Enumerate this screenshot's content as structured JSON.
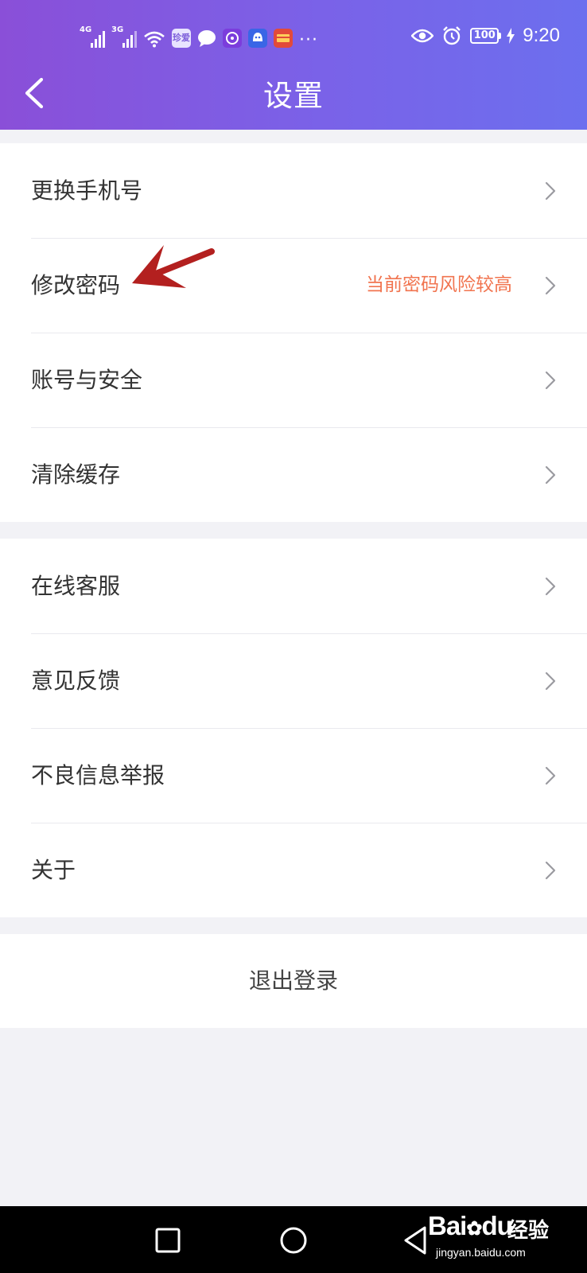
{
  "status_bar": {
    "network_1": "4G",
    "network_2": "3G",
    "app_icon_zhen": "珍爱",
    "more": "···",
    "battery": "100",
    "time": "9:20"
  },
  "header": {
    "title": "设置"
  },
  "group1": [
    {
      "label": "更换手机号",
      "note": ""
    },
    {
      "label": "修改密码",
      "note": "当前密码风险较高"
    },
    {
      "label": "账号与安全",
      "note": ""
    },
    {
      "label": "清除缓存",
      "note": ""
    }
  ],
  "group2": [
    {
      "label": "在线客服",
      "note": ""
    },
    {
      "label": "意见反馈",
      "note": ""
    },
    {
      "label": "不良信息举报",
      "note": ""
    },
    {
      "label": "关于",
      "note": ""
    }
  ],
  "logout": {
    "label": "退出登录"
  },
  "watermark": {
    "logo": "Bai",
    "logo2": "du",
    "cn": "经验",
    "url": "jingyan.baidu.com"
  },
  "colors": {
    "header_start": "#8a4fd8",
    "header_end": "#6c6fee",
    "note": "#f1744f",
    "annotation_arrow": "#b3201f"
  }
}
